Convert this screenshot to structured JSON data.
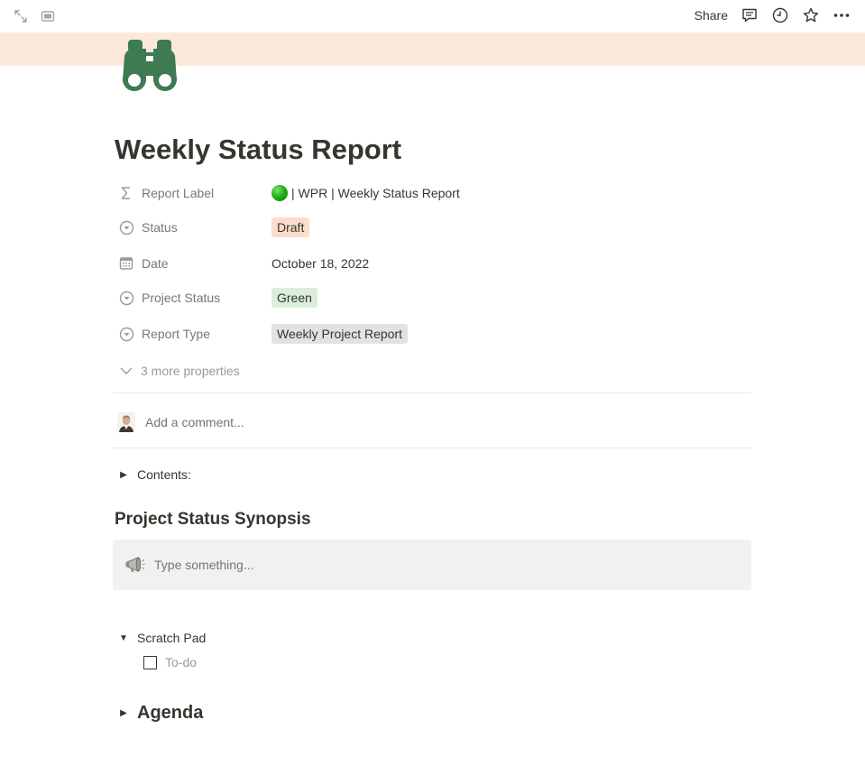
{
  "topbar": {
    "share_label": "Share",
    "icons": [
      "expand-icon",
      "sidebar-icon",
      "comment-icon",
      "history-icon",
      "star-icon",
      "more-icon"
    ]
  },
  "colors": {
    "cover": "#fde9dc",
    "page_icon": "#3e7a52",
    "draft_tag_bg": "#fadec9",
    "green_tag_bg": "#dbeddb",
    "gray_tag_bg": "#e3e2e0",
    "callout_bg": "#f1f1ef"
  },
  "page": {
    "icon": "binoculars-icon",
    "title": "Weekly Status Report"
  },
  "properties": [
    {
      "name": "Report Label",
      "icon": "formula-icon",
      "value": "| WPR | Weekly Status Report",
      "value_prefix_icon": "green-circle-icon"
    },
    {
      "name": "Status",
      "icon": "select-icon",
      "value": "Draft"
    },
    {
      "name": "Date",
      "icon": "calendar-icon",
      "value": "October 18, 2022"
    },
    {
      "name": "Project Status",
      "icon": "select-icon",
      "value": "Green"
    },
    {
      "name": "Report Type",
      "icon": "select-icon",
      "value": "Weekly Project Report"
    }
  ],
  "more_properties_label": "3 more properties",
  "comment": {
    "placeholder": "Add a comment..."
  },
  "contents_toggle": {
    "label": "Contents:"
  },
  "synopsis": {
    "heading": "Project Status Synopsis",
    "callout_icon": "megaphone-icon",
    "placeholder": "Type something..."
  },
  "scratch_pad": {
    "label": "Scratch Pad",
    "todo_placeholder": "To-do"
  },
  "agenda": {
    "label": "Agenda"
  }
}
